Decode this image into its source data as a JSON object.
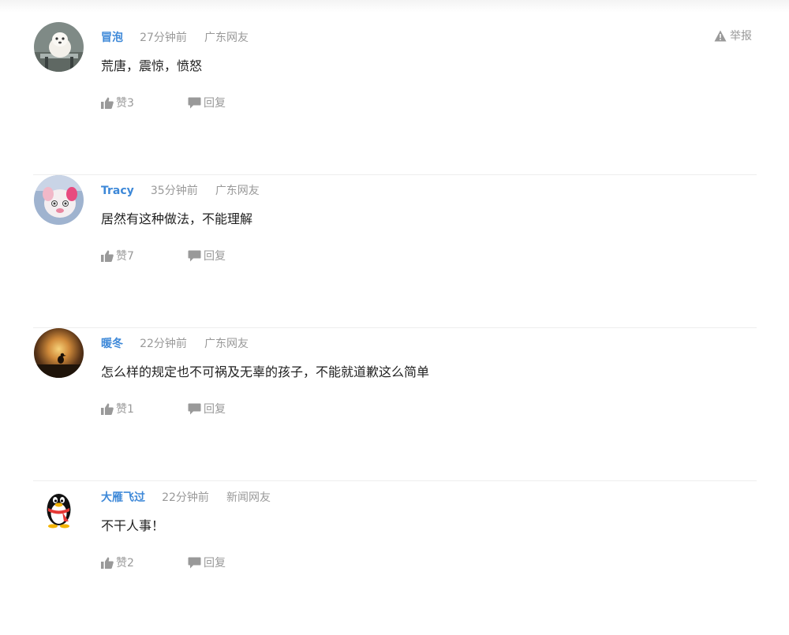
{
  "report_label": "举报",
  "comments": [
    {
      "username": "冒泡",
      "time": "27分钟前",
      "location": "广东网友",
      "content": "荒唐，震惊，愤怒",
      "likes": "赞3",
      "reply_label": "回复",
      "avatar_icon": "dog-photo-icon"
    },
    {
      "username": "Tracy",
      "time": "35分钟前",
      "location": "广东网友",
      "content": "居然有这种做法，不能理解",
      "likes": "赞7",
      "reply_label": "回复",
      "avatar_icon": "pink-toy-photo-icon"
    },
    {
      "username": "暖冬",
      "time": "22分钟前",
      "location": "广东网友",
      "content": "怎么样的规定也不可祸及无辜的孩子，不能就道歉这么简单",
      "likes": "赞1",
      "reply_label": "回复",
      "avatar_icon": "sunset-bird-photo-icon"
    },
    {
      "username": "大雁飞过",
      "time": "22分钟前",
      "location": "新闻网友",
      "content": "不干人事！",
      "likes": "赞2",
      "reply_label": "回复",
      "avatar_icon": "qq-penguin-icon"
    }
  ],
  "colors": {
    "username": "#3d88d8",
    "meta": "#999999",
    "content": "#222222",
    "divider": "#eeeeee"
  }
}
